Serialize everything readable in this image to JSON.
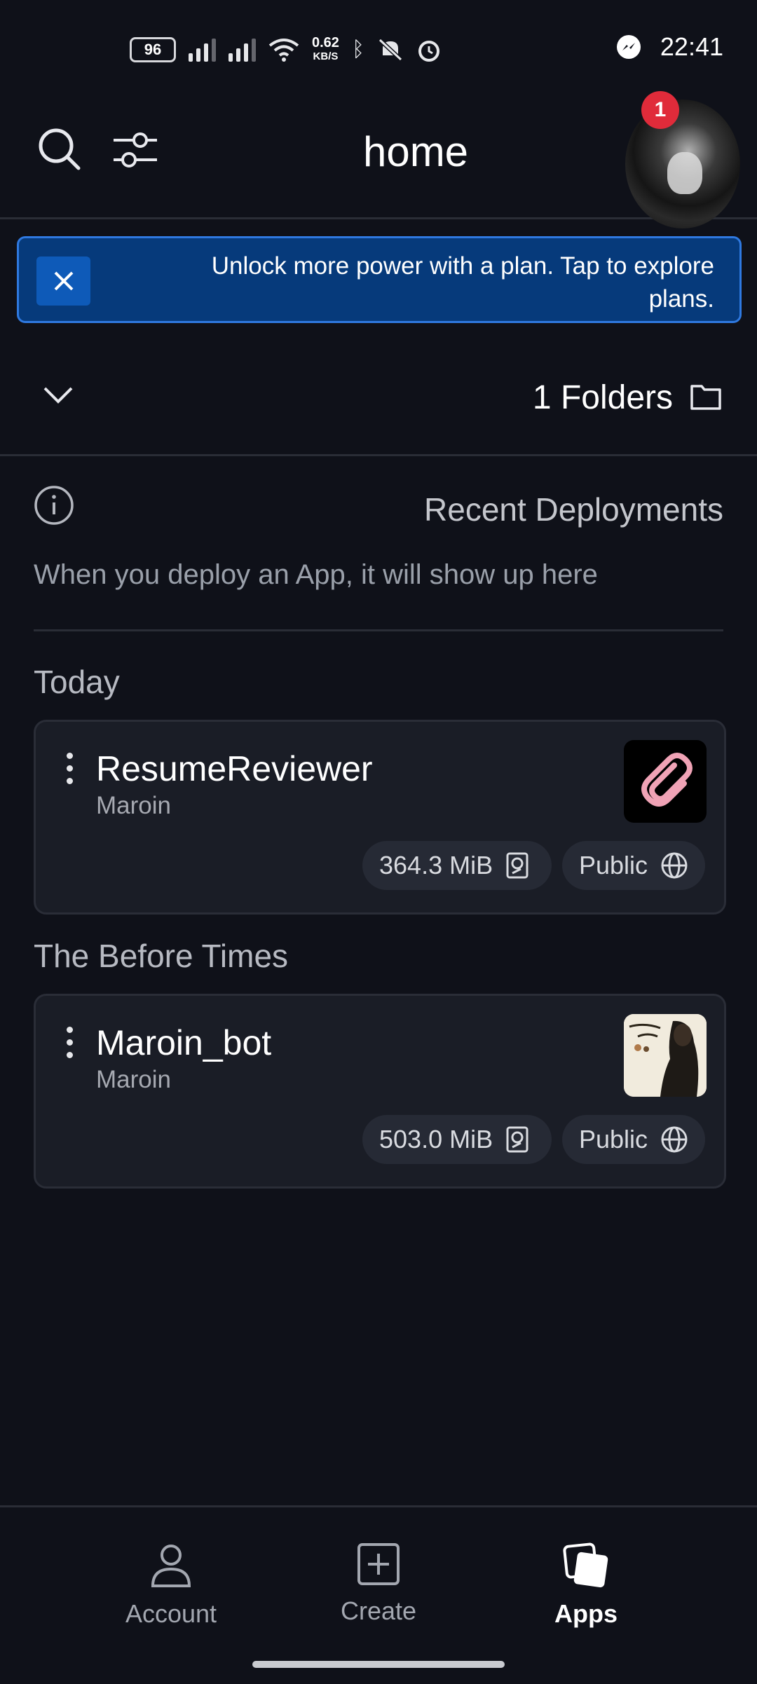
{
  "status_bar": {
    "battery": "96",
    "net_speed_value": "0.62",
    "net_speed_unit": "KB/S",
    "time": "22:41"
  },
  "header": {
    "title": "home",
    "notification_count": "1"
  },
  "banner": {
    "text": "Unlock more power with a plan. Tap to explore plans."
  },
  "folders": {
    "label": "1 Folders"
  },
  "recent": {
    "title": "Recent Deployments",
    "empty_text": "When you deploy an App, it will show up here"
  },
  "sections": [
    {
      "title": "Today",
      "app": {
        "name": "ResumeReviewer",
        "owner": "Maroin",
        "size": "364.3 MiB",
        "visibility": "Public",
        "icon": "paperclip-icon",
        "icon_color": "#f0a3b6"
      }
    },
    {
      "title": "The Before Times",
      "app": {
        "name": "Maroin_bot",
        "owner": "Maroin",
        "size": "503.0 MiB",
        "visibility": "Public",
        "icon": "photo-thumbnail"
      }
    }
  ],
  "bottom_nav": {
    "items": [
      {
        "label": "Account",
        "icon": "person-icon",
        "active": false
      },
      {
        "label": "Create",
        "icon": "plus-square-icon",
        "active": false
      },
      {
        "label": "Apps",
        "icon": "apps-stack-icon",
        "active": true
      }
    ]
  },
  "colors": {
    "background": "#0f1119",
    "banner_bg": "#063a7b",
    "banner_border": "#2f79e0",
    "badge_red": "#e02b3a",
    "card_bg": "#1a1d26"
  }
}
